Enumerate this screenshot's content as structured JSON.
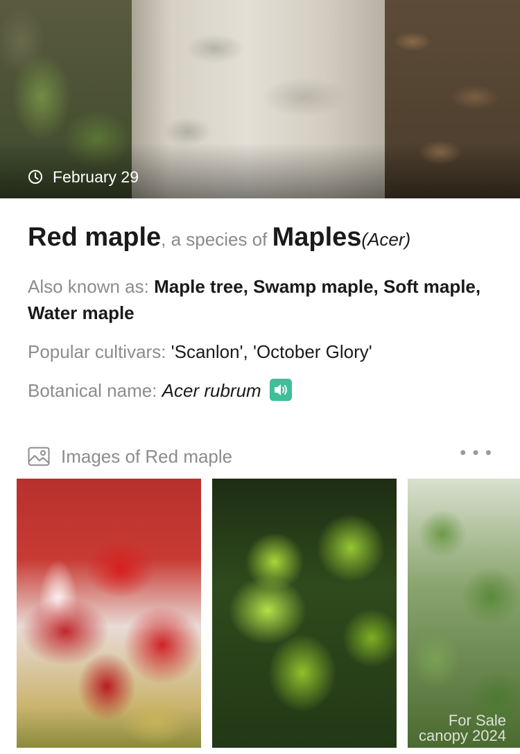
{
  "hero": {
    "date": "February 29",
    "icon": "clock-icon"
  },
  "info": {
    "name": "Red maple",
    "species_connector": ", a species of ",
    "genus": "Maples",
    "genus_latin": "(Acer)",
    "aka_label": "Also known as: ",
    "aka_value": "Maple tree, Swamp maple, Soft maple, Water maple",
    "cultivars_label": "Popular cultivars: ",
    "cultivars_value": "'Scanlon', 'October Glory'",
    "botanical_label": "Botanical name: ",
    "botanical_value": "Acer rubrum",
    "speaker_icon": "speaker-icon",
    "speaker_color": "#3dbf9a"
  },
  "images": {
    "header": "Images of Red maple",
    "header_icon": "gallery-icon",
    "more_icon": "more-icon",
    "items": [
      {
        "alt": "red maple leaves"
      },
      {
        "alt": "green maple leaves"
      },
      {
        "alt": "maple foliage"
      }
    ],
    "watermark_line1": "For Sale",
    "watermark_line2": "canopy 2024"
  }
}
